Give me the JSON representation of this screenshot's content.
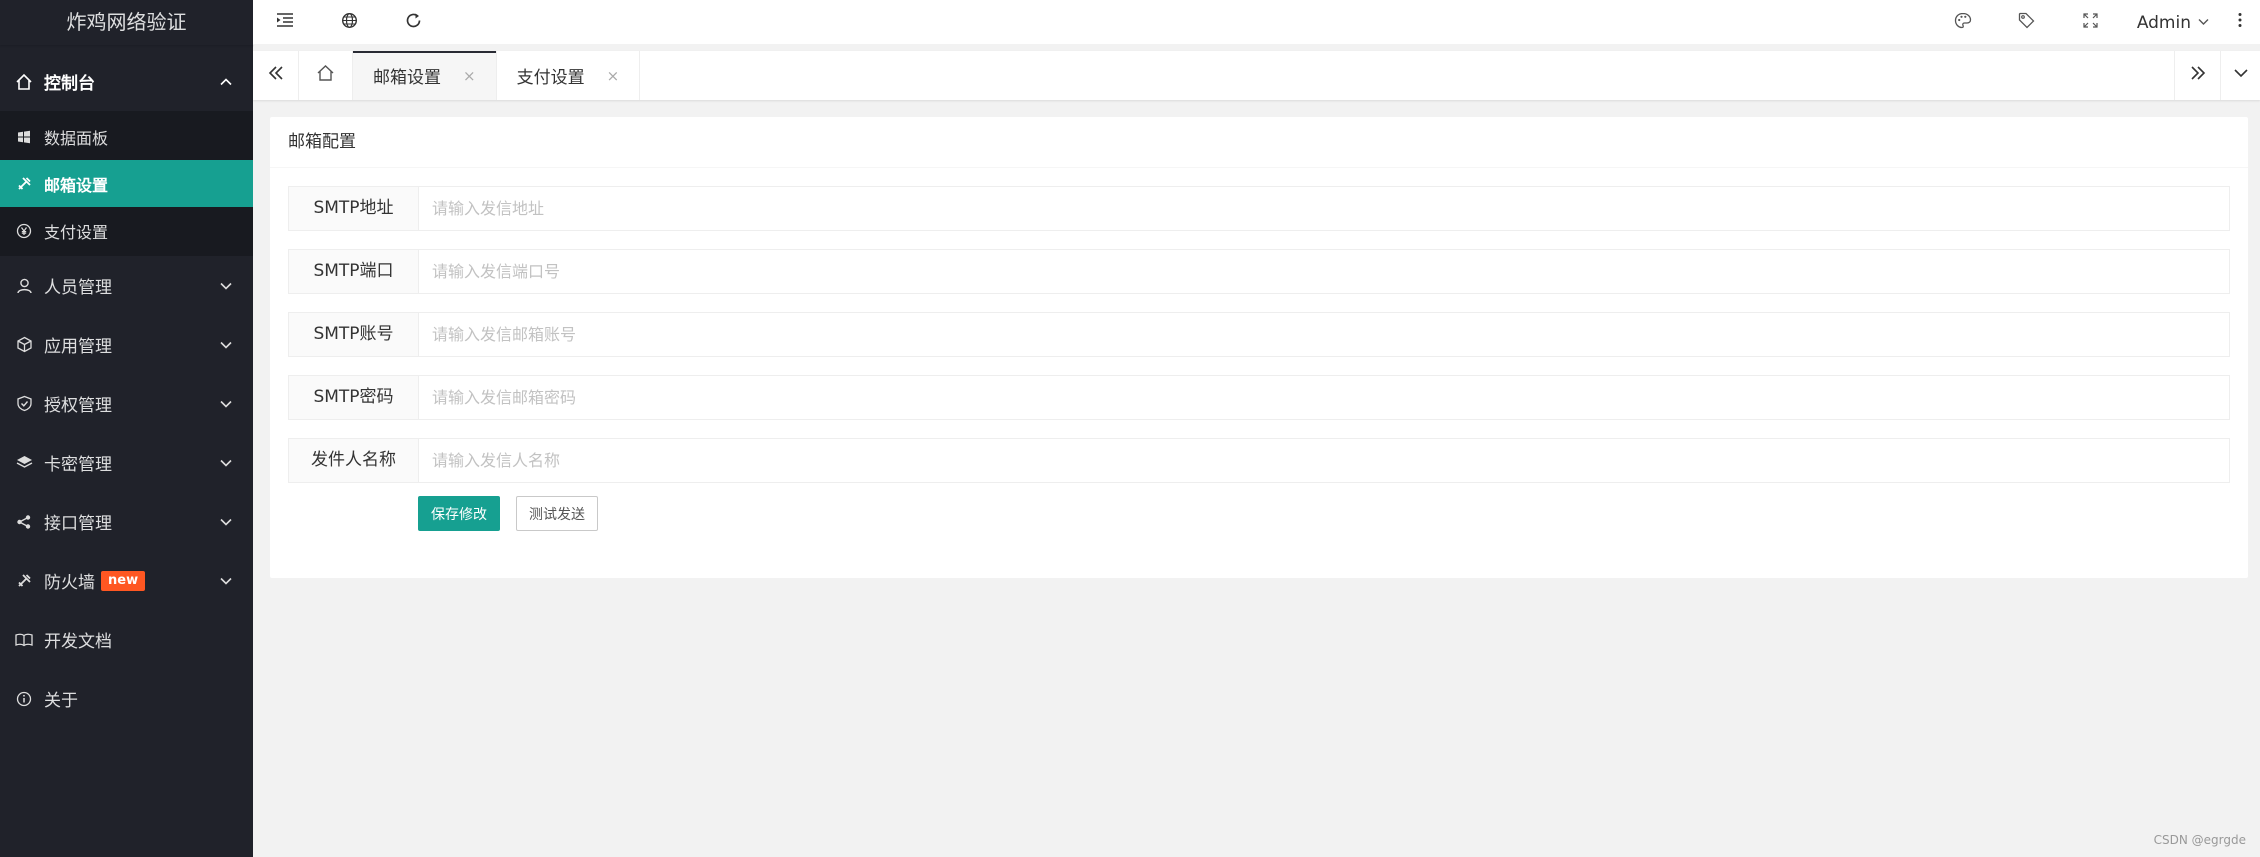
{
  "app": {
    "logo": "炸鸡网络验证"
  },
  "sidebar": {
    "groups": [
      {
        "label": "控制台",
        "icon": "home-icon",
        "expanded": true,
        "items": [
          {
            "label": "数据面板",
            "icon": "windows-icon",
            "active": false
          },
          {
            "label": "邮箱设置",
            "icon": "tools-icon",
            "active": true
          },
          {
            "label": "支付设置",
            "icon": "yen-icon",
            "active": false
          }
        ]
      },
      {
        "label": "人员管理",
        "icon": "user-icon"
      },
      {
        "label": "应用管理",
        "icon": "cube-icon"
      },
      {
        "label": "授权管理",
        "icon": "shield-check-icon"
      },
      {
        "label": "卡密管理",
        "icon": "layers-icon"
      },
      {
        "label": "接口管理",
        "icon": "share-icon"
      },
      {
        "label": "防火墙",
        "icon": "tools-icon",
        "badge": "new"
      },
      {
        "label": "开发文档",
        "icon": "book-icon"
      },
      {
        "label": "关于",
        "icon": "info-icon"
      }
    ]
  },
  "header": {
    "user": "Admin"
  },
  "tabs": [
    {
      "label": "邮箱设置",
      "close": "×",
      "active": true
    },
    {
      "label": "支付设置",
      "close": "×",
      "active": false
    }
  ],
  "card": {
    "title": "邮箱配置",
    "fields": [
      {
        "label": "SMTP地址",
        "placeholder": "请输入发信地址",
        "value": ""
      },
      {
        "label": "SMTP端口",
        "placeholder": "请输入发信端口号",
        "value": ""
      },
      {
        "label": "SMTP账号",
        "placeholder": "请输入发信邮箱账号",
        "value": ""
      },
      {
        "label": "SMTP密码",
        "placeholder": "请输入发信邮箱密码",
        "value": ""
      },
      {
        "label": "发件人名称",
        "placeholder": "请输入发信人名称",
        "value": ""
      }
    ],
    "save_label": "保存修改",
    "test_label": "测试发送"
  },
  "watermark": "CSDN @egrgde",
  "colors": {
    "accent": "#16a091",
    "sidebar_bg": "#20222a",
    "badge": "#ff5722"
  }
}
